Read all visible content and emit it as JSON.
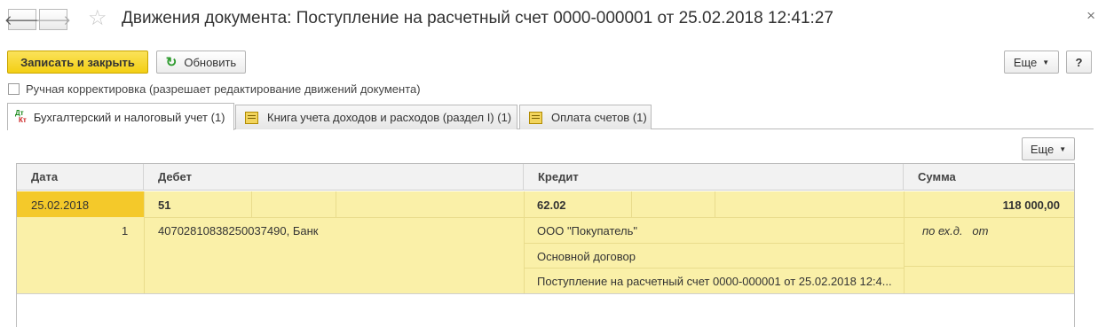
{
  "nav": {
    "back_glyph": "🡐",
    "forward_glyph": "🡒"
  },
  "header": {
    "title": "Движения документа: Поступление на расчетный счет 0000-000001 от 25.02.2018 12:41:27",
    "star_glyph": "☆",
    "close_glyph": "×"
  },
  "toolbar": {
    "save_close_label": "Записать и закрыть",
    "refresh_label": "Обновить",
    "refresh_icon": "↻",
    "more_label": "Еще",
    "help_label": "?"
  },
  "manual_correction": {
    "checked": false,
    "label": "Ручная корректировка (разрешает редактирование движений документа)"
  },
  "tabs": [
    {
      "label": "Бухгалтерский и налоговый учет (1)",
      "icon_top": "Дт",
      "icon_bottom": "Кт",
      "active": true
    },
    {
      "label": "Книга учета доходов и расходов (раздел I) (1)",
      "icon": "register-icon",
      "active": false
    },
    {
      "label": "Оплата счетов (1)",
      "icon": "register-icon",
      "active": false
    }
  ],
  "grid_toolbar": {
    "more_label": "Еще"
  },
  "table": {
    "columns": [
      "Дата",
      "Дебет",
      "Кредит",
      "Сумма"
    ],
    "row": {
      "date": "25.02.2018",
      "line_no": "1",
      "debit_account": "51",
      "debit_sub1": "40702810838250037490, Банк",
      "credit_account": "62.02",
      "credit_sub1": "ООО \"Покупатель\"",
      "credit_sub2": "Основной договор",
      "credit_sub3": "Поступление на расчетный счет 0000-000001 от 25.02.2018 12:4...",
      "amount": "118 000,00",
      "amount_note": "по ех.д.   от"
    }
  },
  "colors": {
    "accent_yellow": "#f4c92a",
    "row_highlight": "#faf0a8",
    "primary_button": "#f5d21c"
  }
}
